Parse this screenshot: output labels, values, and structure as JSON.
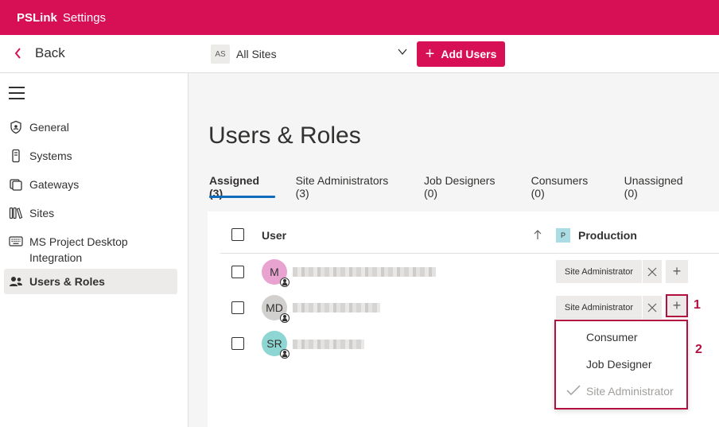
{
  "header": {
    "brand": "PSLink",
    "title": "Settings"
  },
  "toolbar": {
    "back_label": "Back",
    "site_initials": "AS",
    "site_value": "All Sites",
    "add_users_label": "Add Users"
  },
  "sidebar": {
    "items": [
      {
        "label": "General",
        "icon": "shield-icon"
      },
      {
        "label": "Systems",
        "icon": "device-icon"
      },
      {
        "label": "Gateways",
        "icon": "gateway-icon"
      },
      {
        "label": "Sites",
        "icon": "library-icon"
      },
      {
        "label": "MS Project Desktop Integration",
        "icon": "keyboard-icon"
      },
      {
        "label": "Users & Roles",
        "icon": "people-icon",
        "active": true
      }
    ]
  },
  "main": {
    "title": "Users & Roles",
    "tabs": [
      {
        "label": "Assigned (3)",
        "active": true
      },
      {
        "label": "Site Administrators (3)"
      },
      {
        "label": "Job Designers (0)"
      },
      {
        "label": "Consumers (0)"
      },
      {
        "label": "Unassigned (0)"
      }
    ],
    "table": {
      "col_user": "User",
      "site_badge": "P",
      "col_site": "Production",
      "rows": [
        {
          "initials": "M",
          "avatar_color": "#e8a3d1",
          "role": "Site Administrator"
        },
        {
          "initials": "MD",
          "avatar_color": "#d2d0ce",
          "role": "Site Administrator"
        },
        {
          "initials": "SR",
          "avatar_color": "#8ed6d3",
          "role": ""
        }
      ]
    },
    "role_menu": {
      "items": [
        {
          "label": "Consumer",
          "checked": false,
          "disabled": false
        },
        {
          "label": "Job Designer",
          "checked": false,
          "disabled": false
        },
        {
          "label": "Site Administrator",
          "checked": true,
          "disabled": true
        }
      ]
    },
    "callouts": [
      "1",
      "2"
    ]
  },
  "colors": {
    "brand": "#d70f55",
    "callout": "#b4103f",
    "tab_accent": "#0f6cbd"
  }
}
